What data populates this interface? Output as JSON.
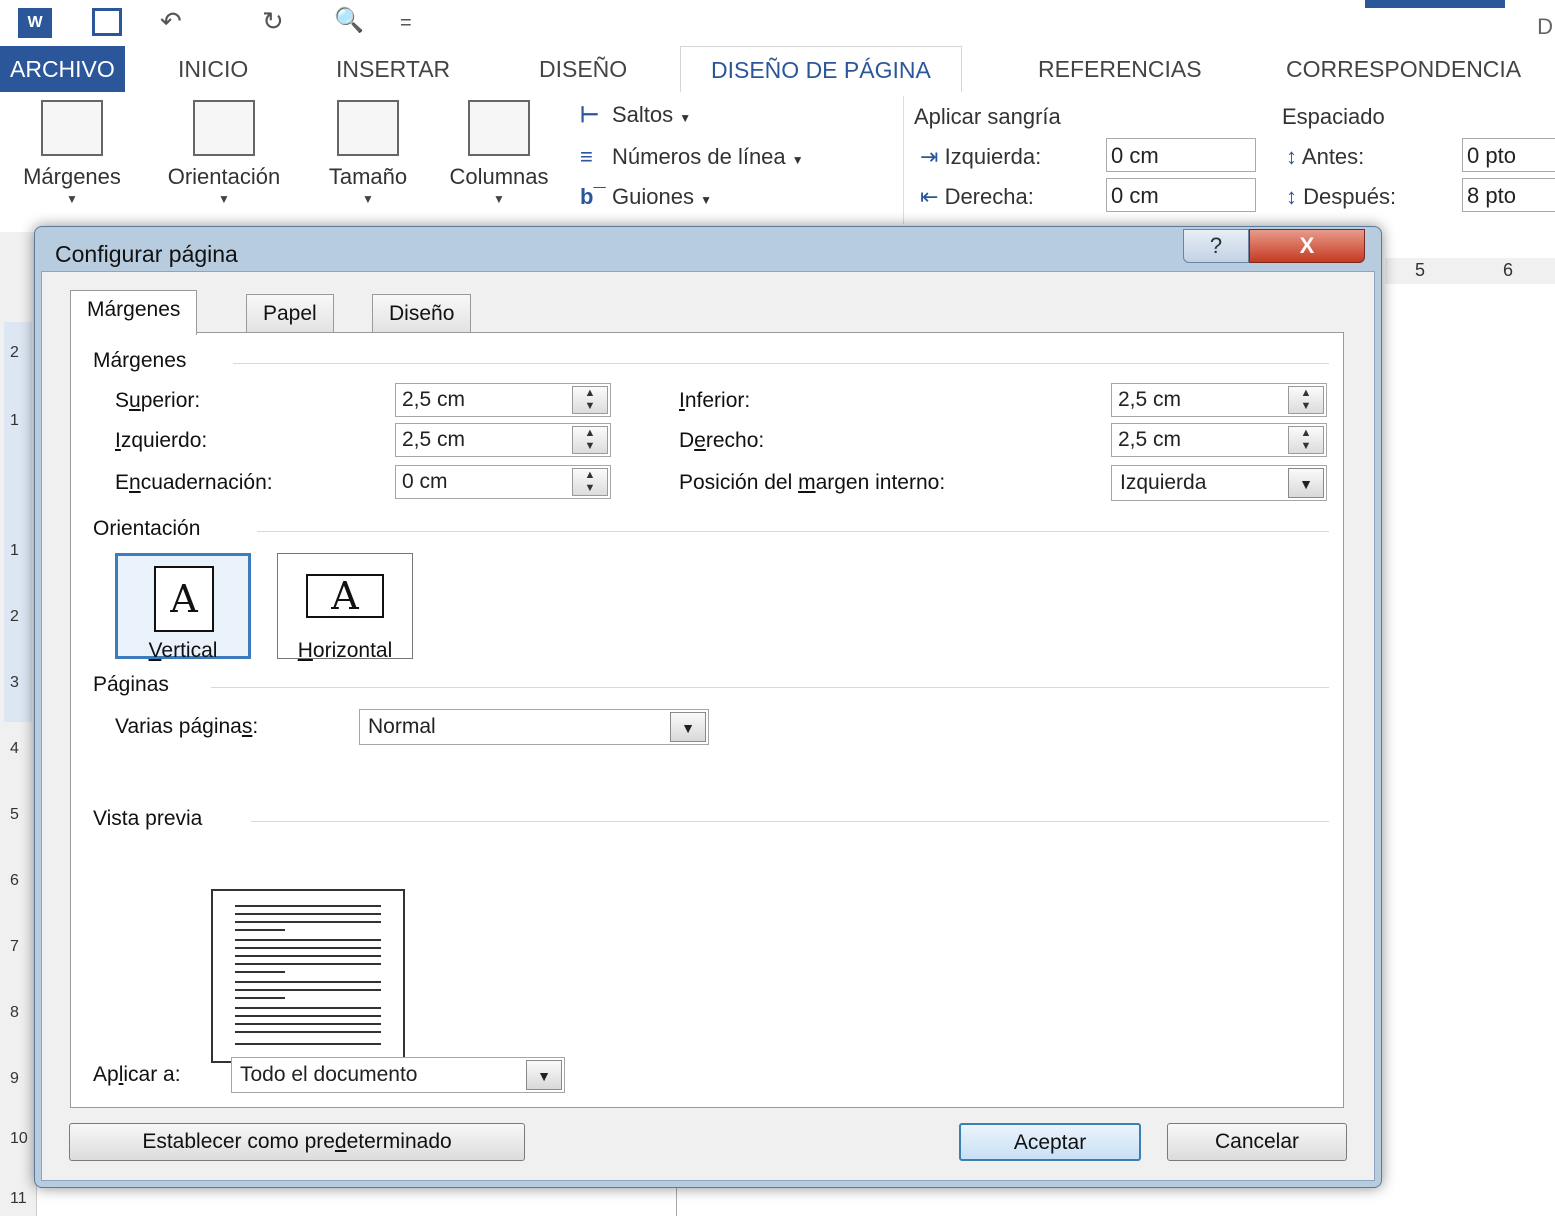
{
  "qat": {
    "undo_icon": "↶",
    "redo_icon": "↻",
    "print_preview_icon": "🔍",
    "customize_icon": "=",
    "title_fragment": "D"
  },
  "ribbon_tabs": [
    "ARCHIVO",
    "INICIO",
    "INSERTAR",
    "DISEÑO",
    "DISEÑO DE PÁGINA",
    "REFERENCIAS",
    "CORRESPONDENCIA"
  ],
  "ribbon": {
    "margins": "Márgenes",
    "orientation": "Orientación",
    "size": "Tamaño",
    "columns": "Columnas",
    "breaks": "Saltos",
    "line_numbers": "Números de línea",
    "hyphenation": "Guiones",
    "indent_title": "Aplicar sangría",
    "indent_left_label": "Izquierda:",
    "indent_left_value": "0 cm",
    "indent_right_label": "Derecha:",
    "indent_right_value": "0 cm",
    "spacing_title": "Espaciado",
    "before_label": "Antes:",
    "before_value": "0 pto",
    "after_label": "Después:",
    "after_value": "8 pto",
    "ruler_5": "5",
    "ruler_6": "6"
  },
  "vertical_ruler": [
    "2",
    "1",
    "1",
    "2",
    "3",
    "4",
    "5",
    "6",
    "7",
    "8",
    "9",
    "10",
    "11"
  ],
  "dialog": {
    "title": "Configurar página",
    "help_label": "?",
    "close_label": "X",
    "tabs": [
      "Márgenes",
      "Papel",
      "Diseño"
    ],
    "margins_section": "Márgenes",
    "top_label_pre": "S",
    "top_label_u": "u",
    "top_label_post": "perior:",
    "top_value": "2,5 cm",
    "bottom_label_u": "I",
    "bottom_label_post": "nferior:",
    "bottom_value": "2,5 cm",
    "left_label_u": "I",
    "left_label_post": "zquierdo:",
    "left_value": "2,5 cm",
    "right_label_pre": "D",
    "right_label_u": "e",
    "right_label_post": "recho:",
    "right_value": "2,5 cm",
    "gutter_label_pre": "E",
    "gutter_label_u": "n",
    "gutter_label_post": "cuadernación:",
    "gutter_value": "0 cm",
    "gutter_pos_label_pre": "Posición del ",
    "gutter_pos_label_u": "m",
    "gutter_pos_label_post": "argen interno:",
    "gutter_pos_value": "Izquierda",
    "orientation_section": "Orientación",
    "portrait_u": "V",
    "portrait_post": "ertical",
    "landscape_u": "H",
    "landscape_post": "orizontal",
    "page_glyph": "A",
    "pages_section": "Páginas",
    "multiple_pages_label_pre": "Varias página",
    "multiple_pages_label_u": "s",
    "multiple_pages_label_post": ":",
    "multiple_pages_value": "Normal",
    "preview_section": "Vista previa",
    "apply_to_label_pre": "Ap",
    "apply_to_label_u": "l",
    "apply_to_label_post": "icar a:",
    "apply_to_value": "Todo el documento",
    "set_default_pre": "Establecer como pre",
    "set_default_u": "d",
    "set_default_post": "eterminado",
    "ok_label": "Aceptar",
    "cancel_label": "Cancelar",
    "spin_up": "▲",
    "spin_down": "▼",
    "dropdown_arrow": "▼"
  }
}
